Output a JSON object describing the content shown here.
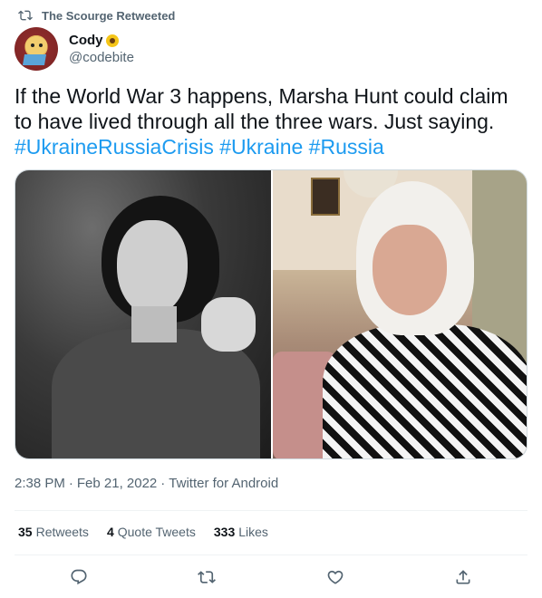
{
  "social_context": {
    "retweeted_by": "The Scourge Retweeted",
    "icon": "retweet-icon"
  },
  "author": {
    "display_name": "Cody",
    "badge_emoji": "sunflower",
    "handle": "@codebite"
  },
  "tweet": {
    "text_plain": "If the World War 3 happens, Marsha Hunt could claim to have lived through all the three wars. Just saying.",
    "hashtags": [
      "#UkraineRussiaCrisis",
      "#Ukraine",
      "#Russia"
    ]
  },
  "media": {
    "photos": [
      {
        "name": "black-and-white-portrait"
      },
      {
        "name": "elderly-woman-portrait"
      }
    ]
  },
  "metadata": {
    "time": "2:38 PM",
    "date": "Feb 21, 2022",
    "source": "Twitter for Android",
    "separator": "·"
  },
  "stats": {
    "retweets_count": "35",
    "retweets_label": "Retweets",
    "quotes_count": "4",
    "quotes_label": "Quote Tweets",
    "likes_count": "333",
    "likes_label": "Likes"
  },
  "actions": [
    "reply-icon",
    "retweet-icon",
    "like-icon",
    "share-icon"
  ],
  "colors": {
    "accent": "#1d9bf0",
    "text": "#0f1419",
    "secondary": "#536471",
    "border": "#eff3f4"
  }
}
